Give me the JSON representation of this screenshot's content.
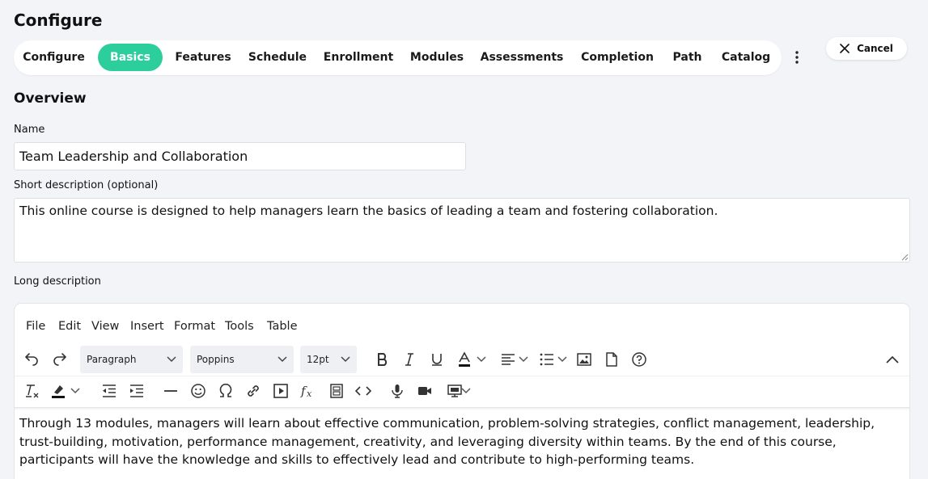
{
  "page": {
    "title": "Configure"
  },
  "tabs": [
    {
      "label": "Configure",
      "active": false
    },
    {
      "label": "Basics",
      "active": true
    },
    {
      "label": "Features",
      "active": false
    },
    {
      "label": "Schedule",
      "active": false
    },
    {
      "label": "Enrollment",
      "active": false
    },
    {
      "label": "Modules",
      "active": false
    },
    {
      "label": "Assessments",
      "active": false
    },
    {
      "label": "Completion",
      "active": false
    },
    {
      "label": "Path",
      "active": false
    },
    {
      "label": "Catalog",
      "active": false
    }
  ],
  "actions": {
    "cancel_label": "Cancel",
    "more_icon": "vertical-ellipsis-icon",
    "cancel_icon": "close-icon"
  },
  "overview": {
    "title": "Overview",
    "name_label": "Name",
    "name_value": "Team Leadership and Collaboration",
    "short_desc_label": "Short description (optional)",
    "short_desc_value": "This online course is designed to help managers learn the basics of leading a team and fostering collaboration.",
    "long_desc_label": "Long description"
  },
  "editor": {
    "menu": [
      "File",
      "Edit",
      "View",
      "Insert",
      "Format",
      "Tools",
      "Table"
    ],
    "block_format": "Paragraph",
    "font_family": "Poppins",
    "font_size": "12pt",
    "content": "Through 13 modules, managers will learn about effective communication, problem-solving strategies, conflict management, leadership, trust-building, motivation, performance management, creativity, and leveraging diversity within teams. By the end of this course, participants will have the knowledge and skills to effectively lead and contribute to high-performing teams.",
    "toolbar_icons": [
      "undo-icon",
      "redo-icon",
      "bold-icon",
      "italic-icon",
      "underline-icon",
      "text-color-icon",
      "align-icon",
      "bullet-list-icon",
      "image-icon",
      "document-icon",
      "help-icon",
      "collapse-icon",
      "clear-format-icon",
      "highlight-icon",
      "outdent-icon",
      "indent-icon",
      "horizontal-rule-icon",
      "emoji-icon",
      "special-char-icon",
      "link-icon",
      "media-icon",
      "formula-icon",
      "template-icon",
      "code-icon",
      "microphone-icon",
      "video-icon",
      "presentation-icon"
    ]
  }
}
